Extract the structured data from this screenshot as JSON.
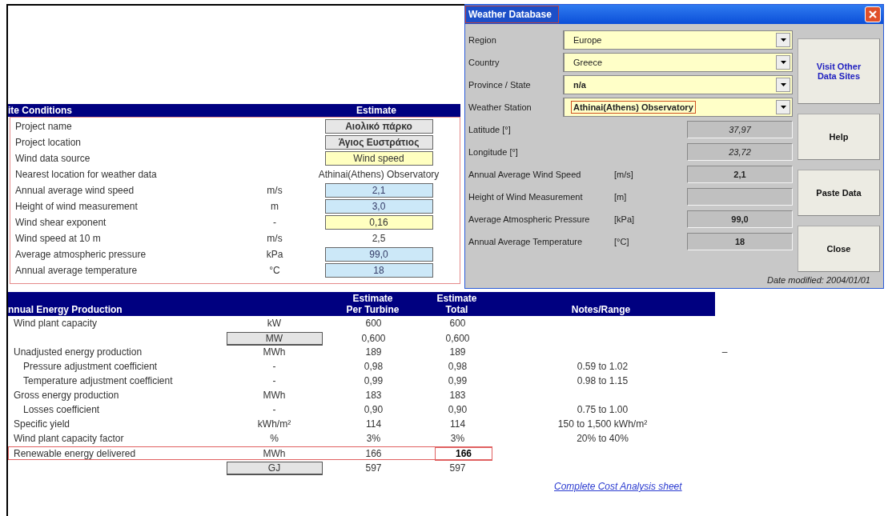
{
  "site_conditions": {
    "title": "ite Conditions",
    "column_header": "Estimate",
    "rows": [
      {
        "label": "Project name",
        "unit": "",
        "value": "Αιολικό πάρκο",
        "kind": "gray"
      },
      {
        "label": "Project location",
        "unit": "",
        "value": "Άγιος Ευστράτιος",
        "kind": "gray"
      },
      {
        "label": "Wind data source",
        "unit": "",
        "value": "Wind speed",
        "kind": "yellow"
      },
      {
        "label": "Nearest location for weather data",
        "unit": "",
        "value": "Athinai(Athens) Observatory",
        "kind": "plain"
      },
      {
        "label": "Annual average wind speed",
        "unit": "m/s",
        "value": "2,1",
        "kind": "blue"
      },
      {
        "label": "Height of wind measurement",
        "unit": "m",
        "value": "3,0",
        "kind": "blue"
      },
      {
        "label": "Wind shear exponent",
        "unit": "-",
        "value": "0,16",
        "kind": "yellow"
      },
      {
        "label": "Wind speed at 10 m",
        "unit": "m/s",
        "value": "2,5",
        "kind": "plain"
      },
      {
        "label": "Average atmospheric pressure",
        "unit": "kPa",
        "value": "99,0",
        "kind": "blue"
      },
      {
        "label": "Annual average temperature",
        "unit": "°C",
        "value": "18",
        "kind": "blue"
      }
    ]
  },
  "energy": {
    "title": "nnual Energy Production",
    "columns": [
      {
        "top": "Estimate",
        "bottom": "Per Turbine"
      },
      {
        "top": "Estimate",
        "bottom": "Total"
      },
      {
        "bottom": "Notes/Range"
      }
    ],
    "rows": [
      {
        "label": "Wind plant capacity",
        "unit": "kW",
        "kind": "text",
        "per_turbine": "600",
        "total": "600",
        "indented": false,
        "highlighted": false,
        "total_bold": false
      },
      {
        "unit": "MW",
        "kind": "button",
        "per_turbine": "0,600",
        "total": "0,600",
        "highlighted": false,
        "total_bold": false
      },
      {
        "label": "Unadjusted energy production",
        "unit": "MWh",
        "kind": "text",
        "per_turbine": "189",
        "total": "189",
        "side": "–",
        "indented": false,
        "highlighted": false,
        "total_bold": false
      },
      {
        "label": "Pressure adjustment coefficient",
        "unit": "-",
        "kind": "text",
        "per_turbine": "0,98",
        "total": "0,98",
        "notes": "0.59 to 1.02",
        "indented": true,
        "highlighted": false,
        "total_bold": false
      },
      {
        "label": "Temperature adjustment coefficient",
        "unit": "-",
        "kind": "text",
        "per_turbine": "0,99",
        "total": "0,99",
        "notes": "0.98 to 1.15",
        "indented": true,
        "highlighted": false,
        "total_bold": false
      },
      {
        "label": "Gross energy production",
        "unit": "MWh",
        "kind": "text",
        "per_turbine": "183",
        "total": "183",
        "indented": false,
        "highlighted": false,
        "total_bold": false
      },
      {
        "label": "Losses coefficient",
        "unit": "-",
        "kind": "text",
        "per_turbine": "0,90",
        "total": "0,90",
        "notes": "0.75 to 1.00",
        "indented": true,
        "highlighted": false,
        "total_bold": false
      },
      {
        "label": "Specific yield",
        "unit": "kWh/m²",
        "kind": "text",
        "per_turbine": "114",
        "total": "114",
        "notes": "150 to 1,500 kWh/m²",
        "indented": false,
        "highlighted": false,
        "total_bold": false
      },
      {
        "label": "Wind plant capacity factor",
        "unit": "%",
        "kind": "text",
        "per_turbine": "3%",
        "total": "3%",
        "notes": "20% to 40%",
        "indented": false,
        "highlighted": false,
        "total_bold": false
      },
      {
        "label": "Renewable energy delivered",
        "unit": "MWh",
        "kind": "text",
        "per_turbine": "166",
        "total": "166",
        "indented": false,
        "highlighted": true,
        "total_bold": true
      },
      {
        "unit": "GJ",
        "kind": "button",
        "per_turbine": "597",
        "total": "597",
        "highlighted": false,
        "total_bold": false
      }
    ],
    "link": "Complete Cost Analysis sheet"
  },
  "dialog": {
    "title": "Weather Database",
    "combos": [
      {
        "label": "Region",
        "value": "Europe",
        "bold": false,
        "focused": false
      },
      {
        "label": "Country",
        "value": "Greece",
        "bold": false,
        "focused": false
      },
      {
        "label": "Province / State",
        "value": "n/a",
        "bold": true,
        "focused": false
      },
      {
        "label": "Weather Station",
        "value": "Athinai(Athens) Observatory",
        "bold": true,
        "focused": true
      }
    ],
    "readouts": [
      {
        "label": "Latitude [°]",
        "value": "37,97",
        "bold": false
      },
      {
        "label": "Longitude [°]",
        "value": "23,72",
        "bold": false
      },
      {
        "label": "Annual Average Wind Speed",
        "unit": "[m/s]",
        "value": "2,1",
        "bold": true
      },
      {
        "label": "Height of Wind Measurement",
        "unit": "[m]"
      },
      {
        "label": "Average Atmospheric Pressure",
        "unit": "[kPa]",
        "value": "99,0",
        "bold": true
      },
      {
        "label": "Annual Average Temperature",
        "unit": "[°C]",
        "value": "18",
        "bold": true
      }
    ],
    "buttons": [
      {
        "label": "Visit Other Data Sites",
        "kind": "link"
      },
      {
        "label": "Help",
        "kind": "plain"
      },
      {
        "label": "Paste Data",
        "kind": "plain"
      },
      {
        "label": "Close",
        "kind": "plain"
      }
    ],
    "footer": "Date modified: 2004/01/01"
  }
}
